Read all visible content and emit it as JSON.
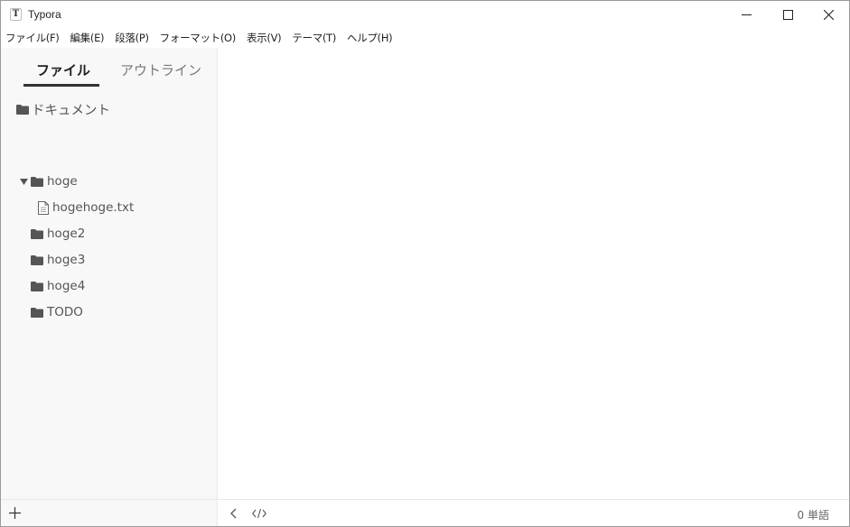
{
  "window": {
    "title": "Typora",
    "app_icon_letter": "T"
  },
  "menu": {
    "items": [
      "ファイル(F)",
      "編集(E)",
      "段落(P)",
      "フォーマット(O)",
      "表示(V)",
      "テーマ(T)",
      "ヘルプ(H)"
    ]
  },
  "sidebar": {
    "tabs": [
      {
        "label": "ファイル",
        "active": true
      },
      {
        "label": "アウトライン",
        "active": false
      }
    ],
    "tree": [
      {
        "label": "ドキュメント",
        "type": "folder",
        "expanded": false
      },
      {
        "label": "hoge",
        "type": "folder",
        "expanded": true
      },
      {
        "label": "hogehoge.txt",
        "type": "file"
      },
      {
        "label": "hoge2",
        "type": "folder",
        "expanded": false
      },
      {
        "label": "hoge3",
        "type": "folder",
        "expanded": false
      },
      {
        "label": "hoge4",
        "type": "folder",
        "expanded": false
      },
      {
        "label": "TODO",
        "type": "folder",
        "expanded": false
      }
    ]
  },
  "status": {
    "word_count": "0 単語"
  },
  "icons": {
    "window_controls": [
      "minimize-icon",
      "maximize-icon",
      "close-icon"
    ],
    "sidebar_footer": "plus-icon",
    "status_left": [
      "chevron-left-icon",
      "code-icon"
    ]
  },
  "colors": {
    "sidebar_bg": "#f8f8f8",
    "active_tab_underline": "#333333",
    "folder_icon": "#555555"
  }
}
